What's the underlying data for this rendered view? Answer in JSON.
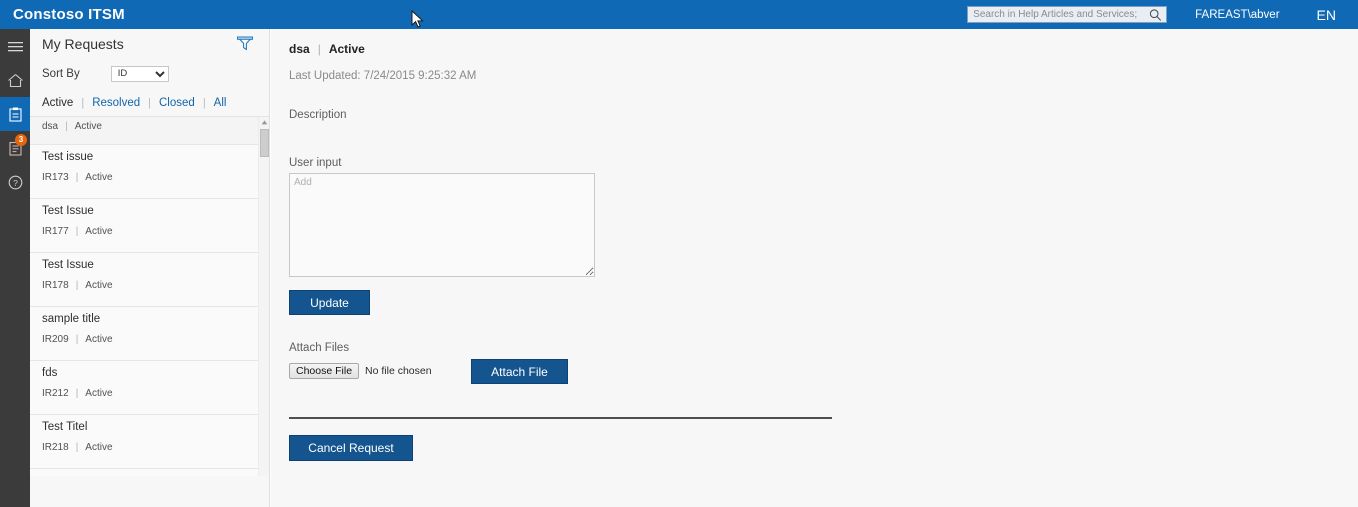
{
  "app": {
    "brand": "Constoso ITSM",
    "accent_blue": "#0f69b4",
    "button_blue": "#14558f",
    "badge_orange": "#e8640c"
  },
  "topbar": {
    "search_placeholder": "Search in Help Articles and Services;",
    "search_value": "",
    "search_icon": "search-icon",
    "user": "FAREAST\\abver",
    "language": "EN"
  },
  "rail": {
    "items": [
      {
        "icon": "hamburger-menu-icon",
        "label": "Menu",
        "selected": false,
        "badge": ""
      },
      {
        "icon": "home-icon",
        "label": "Home",
        "selected": false,
        "badge": ""
      },
      {
        "icon": "clipboard-icon",
        "label": "My Requests",
        "selected": true,
        "badge": ""
      },
      {
        "icon": "document-list-icon",
        "label": "Notifications",
        "selected": false,
        "badge": "3"
      },
      {
        "icon": "help-question-icon",
        "label": "Help",
        "selected": false,
        "badge": ""
      }
    ]
  },
  "panel": {
    "title": "My Requests",
    "filter_icon": "funnel-filter-icon",
    "sort_label": "Sort By",
    "sort_value": "ID",
    "sort_options": [
      "ID"
    ],
    "tabs": [
      {
        "label": "Active",
        "active": true
      },
      {
        "label": "Resolved",
        "active": false
      },
      {
        "label": "Closed",
        "active": false
      },
      {
        "label": "All",
        "active": false
      }
    ],
    "tab_separator": "|",
    "meta_separator": "|",
    "requests": [
      {
        "title": "",
        "id": "dsa",
        "status": "Active",
        "partial": true
      },
      {
        "title": "Test issue",
        "id": "IR173",
        "status": "Active",
        "partial": false
      },
      {
        "title": "Test Issue",
        "id": "IR177",
        "status": "Active",
        "partial": false
      },
      {
        "title": "Test Issue",
        "id": "IR178",
        "status": "Active",
        "partial": false
      },
      {
        "title": "sample title",
        "id": "IR209",
        "status": "Active",
        "partial": false
      },
      {
        "title": "fds",
        "id": "IR212",
        "status": "Active",
        "partial": false
      },
      {
        "title": "Test Titel",
        "id": "IR218",
        "status": "Active",
        "partial": false
      }
    ]
  },
  "main": {
    "crumb_title": "dsa",
    "crumb_separator": "|",
    "crumb_status": "Active",
    "last_updated": "Last Updated: 7/24/2015 9:25:32 AM",
    "description_label": "Description",
    "description_value": "",
    "user_input_label": "User input",
    "user_input_placeholder": "Add",
    "user_input_value": "",
    "update_button": "Update",
    "attach_files_label": "Attach Files",
    "choose_file_button": "Choose File",
    "no_file_text": "No file chosen",
    "attach_file_button": "Attach File",
    "cancel_button": "Cancel Request"
  }
}
